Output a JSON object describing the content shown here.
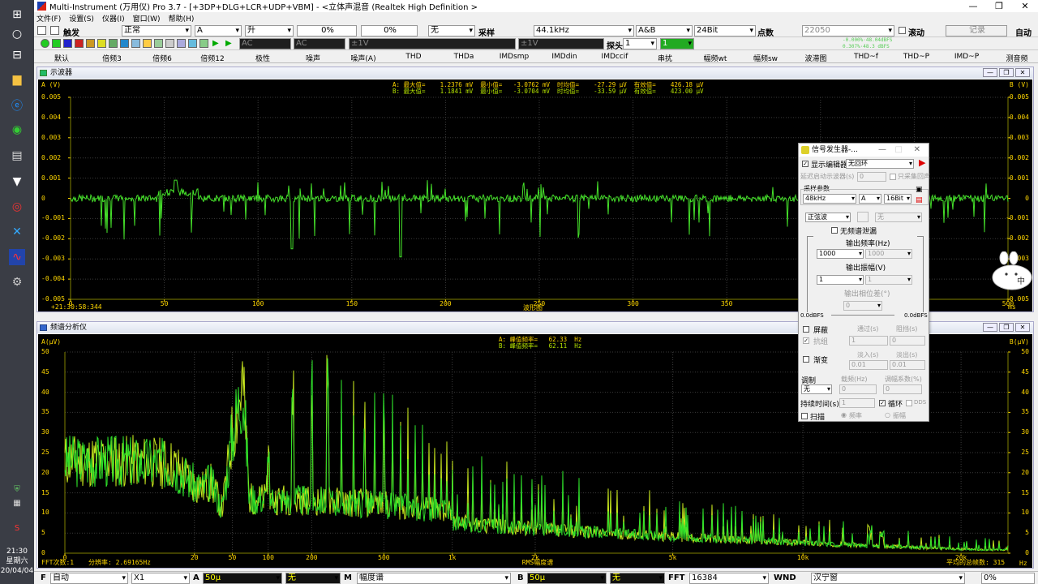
{
  "taskbar": {
    "time": "21:30",
    "weekday": "星期六",
    "date": "20/04/04"
  },
  "window": {
    "title": "Multi-Instrument (万用仪)  Pro 3.7  -  [+3DP+DLG+LCR+UDP+VBM]  -  <立体声混音 (Realtek High Definition >",
    "min": "—",
    "max": "❐",
    "close": "✕"
  },
  "menu": [
    "文件(F)",
    "设置(S)",
    "仪器(I)",
    "窗口(W)",
    "帮助(H)"
  ],
  "toolbar1": {
    "trigger_label": "触发",
    "mode": "正常",
    "channel": "A",
    "edge": "升",
    "level": "0%",
    "delay": "0%",
    "none": "无",
    "sample_label": "采样",
    "sample_rate": "44.1kHz",
    "channels": "A&B",
    "bits": "24Bit",
    "points_label": "点数",
    "points": "22050",
    "scroll_label": "滚动",
    "record": "记录",
    "auto": "自动"
  },
  "toolbar2": {
    "ac1": "AC",
    "ac2": "AC",
    "range1": "±1V",
    "range2": "±1V",
    "probe_label": "探头",
    "probe1": "1",
    "probe2": "1",
    "meter_top": "-0.000%·48.04dBFS",
    "meter_bot": "0.307%·48.3 dBFS"
  },
  "tabs": [
    "默认",
    "倍频3",
    "倍频6",
    "倍频12",
    "极性",
    "噪声",
    "噪声(A)",
    "THD",
    "THDa",
    "IMDsmp",
    "IMDdin",
    "IMDccif",
    "串扰",
    "幅频wt",
    "幅频sw",
    "波滞图",
    "THD~f",
    "THD~P",
    "IMD~P",
    "测音频"
  ],
  "osc": {
    "title": "示波器",
    "left_unit": "A (V)",
    "right_unit": "B (V)",
    "yticks": [
      "0.005",
      "0.004",
      "0.003",
      "0.002",
      "0.001",
      "0",
      "-0.001",
      "-0.002",
      "-0.003",
      "-0.004",
      "-0.005"
    ],
    "xticks": [
      "0",
      "50",
      "100",
      "150",
      "200",
      "250",
      "300",
      "350",
      "400",
      "450",
      "500"
    ],
    "xunit": "ms",
    "xtitle": "波形图",
    "time": "+21:30:58:344",
    "statA": "A: 最大值=    1.2376 mV  最小值=   -3.0762 mV  时均值=    -27.29 μV  有效值=    426.18 μV",
    "statB": "B: 最大值=    1.1841 mV  最小值=   -3.0704 mV  时均值=    -33.59 μV  有效值=    423.00 μV"
  },
  "spec": {
    "title": "频谱分析仪",
    "left_unit": "A(μV)",
    "right_unit": "B(μV)",
    "yticks": [
      "50",
      "45",
      "40",
      "35",
      "30",
      "25",
      "20",
      "15",
      "10",
      "5",
      "0"
    ],
    "xticks": [
      "0",
      "20",
      "50",
      "100",
      "200",
      "500",
      "1k",
      "2k",
      "5k",
      "10k",
      "20k"
    ],
    "xunit": "Hz",
    "xtitle": "RMS幅度谱",
    "fft_count": "FFT次数:1",
    "resolution": "分辨率: 2.69165Hz",
    "avg": "平均的总帧数: 315",
    "statA": "A: 峰值频率=   62.33  Hz",
    "statB": "B: 峰值频率=   62.11  Hz"
  },
  "gen": {
    "title": "信号发生器-...",
    "show_editor": "显示编辑器",
    "loop": "无回环",
    "delay_label": "延迟启动示波器(s)",
    "delay_val": "0",
    "only_sample": "只采集回声",
    "sample_params": "采样参数",
    "rate": "48kHz",
    "ch": "A",
    "bits": "16Bit",
    "wave": "正弦波",
    "wave2": "无",
    "no_alias": "无频谱泄漏",
    "freq_label": "输出频率(Hz)",
    "freq": "1000",
    "freq2": "1000",
    "amp_label": "输出振幅(V)",
    "amp": "1",
    "amp2": "1",
    "phase_label": "输出相位差(°)",
    "phase": "0",
    "dbfs_l": "0.0dBFS",
    "dbfs_r": "0.0dBFS",
    "mask": "屏蔽",
    "pass": "通过(s)",
    "block": "阻挡(s)",
    "mask_group": "抗组",
    "one": "1",
    "zero": "0",
    "fade": "渐变",
    "fade_in": "淡入(s)",
    "fade_out": "淡出(s)",
    "fi": "0.01",
    "fo": "0.01",
    "mod_label": "调制",
    "carrier": "载频(Hz)",
    "mod_coef": "调幅系数(%)",
    "mod": "无",
    "c0": "0",
    "m0": "0",
    "dur_label": "持续时间(s)",
    "dur": "1",
    "cycle": "循环",
    "dds": "DDS",
    "sweep": "扫描",
    "sf": "频率",
    "sa": "振幅"
  },
  "bottom": {
    "f_label": "F",
    "f_mode": "自动",
    "x1": "X1",
    "a_label": "A",
    "a_val": "50μ",
    "a_none": "无",
    "m_label": "M",
    "m_val": "幅度谱",
    "b_label": "B",
    "b_val": "50μ",
    "b_none": "无",
    "fft_label": "FFT",
    "fft": "16384",
    "wnd_label": "WND",
    "wnd": "汉宁窗",
    "pct": "0%"
  },
  "chart_data": [
    {
      "type": "line",
      "title": "",
      "xlabel": "波形图",
      "ylabel": "A (V)",
      "xlim": [
        0,
        500
      ],
      "ylim": [
        -0.005,
        0.005
      ],
      "series": [
        {
          "name": "A",
          "values": [
            0,
            0,
            0.0002,
            -0.0003,
            0.0008,
            0.0001,
            0,
            -0.0001,
            0,
            0,
            0,
            0,
            0,
            0,
            0,
            0.0002
          ]
        },
        {
          "name": "B",
          "values": [
            0,
            0,
            0.0002,
            -0.0003,
            0.0008,
            0.0001,
            0,
            -0.0001,
            0,
            0,
            0,
            0,
            0,
            0,
            0,
            0.0002
          ]
        }
      ],
      "x": [
        0,
        25,
        50,
        60,
        55,
        100,
        150,
        200,
        250,
        300,
        350,
        400,
        450,
        500,
        480,
        420
      ]
    },
    {
      "type": "line",
      "title": "",
      "xlabel": "RMS幅度谱",
      "ylabel": "A(μV)",
      "xlim": [
        0,
        24000
      ],
      "ylim": [
        0,
        50
      ],
      "series": [
        {
          "name": "A",
          "x": [
            0,
            10,
            20,
            25,
            30,
            40,
            50,
            62,
            70,
            100,
            120,
            150,
            200,
            300,
            500,
            1000,
            2000,
            5000,
            10000,
            20000,
            24000
          ],
          "values": [
            27,
            26,
            20,
            19,
            21,
            13,
            35,
            50,
            20,
            23,
            47,
            46,
            50,
            40,
            37,
            26,
            12,
            8,
            4,
            1,
            0
          ]
        }
      ]
    }
  ]
}
